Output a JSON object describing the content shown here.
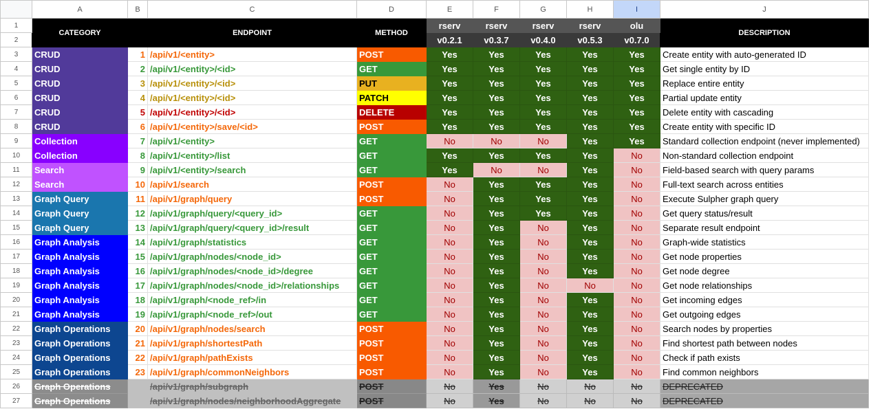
{
  "columns": [
    "A",
    "B",
    "C",
    "D",
    "E",
    "F",
    "G",
    "H",
    "I",
    "J"
  ],
  "selected_column": "I",
  "headers": {
    "category": "CATEGORY",
    "endpoint": "ENDPOINT",
    "method": "METHOD",
    "description": "DESCRIPTION",
    "versions": [
      {
        "name": "rserv",
        "ver": "v0.2.1"
      },
      {
        "name": "rserv",
        "ver": "v0.3.7"
      },
      {
        "name": "rserv",
        "ver": "v0.4.0"
      },
      {
        "name": "rserv",
        "ver": "v0.5.3"
      },
      {
        "name": "olu",
        "ver": "v0.7.0"
      }
    ]
  },
  "category_colors": {
    "CRUD": "#513a9a",
    "Collection": "#8800ff",
    "Search": "#c052ff",
    "Graph Query": "#1a76ae",
    "Graph Analysis": "#0000ff",
    "Graph Operations": "#0d4690"
  },
  "method_colors": {
    "POST": {
      "bg": "#f85a00",
      "fg": "#ffffff",
      "text": "#f4680a"
    },
    "GET": {
      "bg": "#38983a",
      "fg": "#ffffff",
      "text": "#38983a"
    },
    "PUT": {
      "bg": "#e8b120",
      "fg": "#000000",
      "text": "#b8900a"
    },
    "PATCH": {
      "bg": "#ffff00",
      "fg": "#000000",
      "text": "#b8900a"
    },
    "DELETE": {
      "bg": "#b80000",
      "fg": "#ffffff",
      "text": "#c00000"
    }
  },
  "rows": [
    {
      "category": "CRUD",
      "num": "1",
      "endpoint": "/api/v1/<entity>",
      "method": "POST",
      "support": [
        "Yes",
        "Yes",
        "Yes",
        "Yes",
        "Yes"
      ],
      "description": "Create entity with auto-generated ID"
    },
    {
      "category": "CRUD",
      "num": "2",
      "endpoint": "/api/v1/<entity>/<id>",
      "method": "GET",
      "support": [
        "Yes",
        "Yes",
        "Yes",
        "Yes",
        "Yes"
      ],
      "description": "Get single entity by ID"
    },
    {
      "category": "CRUD",
      "num": "3",
      "endpoint": "/api/v1/<entity>/<id>",
      "method": "PUT",
      "support": [
        "Yes",
        "Yes",
        "Yes",
        "Yes",
        "Yes"
      ],
      "description": "Replace entire entity"
    },
    {
      "category": "CRUD",
      "num": "4",
      "endpoint": "/api/v1/<entity>/<id>",
      "method": "PATCH",
      "support": [
        "Yes",
        "Yes",
        "Yes",
        "Yes",
        "Yes"
      ],
      "description": "Partial update entity"
    },
    {
      "category": "CRUD",
      "num": "5",
      "endpoint": "/api/v1/<entity>/<id>",
      "method": "DELETE",
      "support": [
        "Yes",
        "Yes",
        "Yes",
        "Yes",
        "Yes"
      ],
      "description": "Delete entity with cascading"
    },
    {
      "category": "CRUD",
      "num": "6",
      "endpoint": "/api/v1/<entity>/save/<id>",
      "method": "POST",
      "support": [
        "Yes",
        "Yes",
        "Yes",
        "Yes",
        "Yes"
      ],
      "description": "Create entity with specific ID"
    },
    {
      "category": "Collection",
      "num": "7",
      "endpoint": "/api/v1/<entity>",
      "method": "GET",
      "support": [
        "No",
        "No",
        "No",
        "Yes",
        "Yes"
      ],
      "description": "Standard collection endpoint (never implemented)"
    },
    {
      "category": "Collection",
      "num": "8",
      "endpoint": "/api/v1/<entity>/list",
      "method": "GET",
      "support": [
        "Yes",
        "Yes",
        "Yes",
        "Yes",
        "No"
      ],
      "description": "Non-standard collection endpoint"
    },
    {
      "category": "Search",
      "num": "9",
      "endpoint": "/api/v1/<entity>/search",
      "method": "GET",
      "support": [
        "Yes",
        "No",
        "No",
        "Yes",
        "No"
      ],
      "description": "Field-based search with query params"
    },
    {
      "category": "Search",
      "num": "10",
      "endpoint": "/api/v1/search",
      "method": "POST",
      "support": [
        "No",
        "Yes",
        "Yes",
        "Yes",
        "No"
      ],
      "description": "Full-text search across entities"
    },
    {
      "category": "Graph Query",
      "num": "11",
      "endpoint": "/api/v1/graph/query",
      "method": "POST",
      "support": [
        "No",
        "Yes",
        "Yes",
        "Yes",
        "No"
      ],
      "description": "Execute Sulpher graph query"
    },
    {
      "category": "Graph Query",
      "num": "12",
      "endpoint": "/api/v1/graph/query/<query_id>",
      "method": "GET",
      "support": [
        "No",
        "Yes",
        "Yes",
        "Yes",
        "No"
      ],
      "description": "Get query status/result"
    },
    {
      "category": "Graph Query",
      "num": "13",
      "endpoint": "/api/v1/graph/query/<query_id>/result",
      "method": "GET",
      "support": [
        "No",
        "Yes",
        "No",
        "Yes",
        "No"
      ],
      "description": "Separate result endpoint"
    },
    {
      "category": "Graph Analysis",
      "num": "14",
      "endpoint": "/api/v1/graph/statistics",
      "method": "GET",
      "support": [
        "No",
        "Yes",
        "No",
        "Yes",
        "No"
      ],
      "description": "Graph-wide statistics"
    },
    {
      "category": "Graph Analysis",
      "num": "15",
      "endpoint": "/api/v1/graph/nodes/<node_id>",
      "method": "GET",
      "support": [
        "No",
        "Yes",
        "No",
        "Yes",
        "No"
      ],
      "description": "Get node properties"
    },
    {
      "category": "Graph Analysis",
      "num": "16",
      "endpoint": "/api/v1/graph/nodes/<node_id>/degree",
      "method": "GET",
      "support": [
        "No",
        "Yes",
        "No",
        "Yes",
        "No"
      ],
      "description": "Get node degree"
    },
    {
      "category": "Graph Analysis",
      "num": "17",
      "endpoint": "/api/v1/graph/nodes/<node_id>/relationships",
      "method": "GET",
      "support": [
        "No",
        "Yes",
        "No",
        "No",
        "No"
      ],
      "description": "Get node relationships"
    },
    {
      "category": "Graph Analysis",
      "num": "18",
      "endpoint": "/api/v1/graph/<node_ref>/in",
      "method": "GET",
      "support": [
        "No",
        "Yes",
        "No",
        "Yes",
        "No"
      ],
      "description": "Get incoming edges"
    },
    {
      "category": "Graph Analysis",
      "num": "19",
      "endpoint": "/api/v1/graph/<node_ref>/out",
      "method": "GET",
      "support": [
        "No",
        "Yes",
        "No",
        "Yes",
        "No"
      ],
      "description": "Get outgoing edges"
    },
    {
      "category": "Graph Operations",
      "num": "20",
      "endpoint": "/api/v1/graph/nodes/search",
      "method": "POST",
      "support": [
        "No",
        "Yes",
        "No",
        "Yes",
        "No"
      ],
      "description": "Search nodes by properties"
    },
    {
      "category": "Graph Operations",
      "num": "21",
      "endpoint": "/api/v1/graph/shortestPath",
      "method": "POST",
      "support": [
        "No",
        "Yes",
        "No",
        "Yes",
        "No"
      ],
      "description": "Find shortest path between nodes"
    },
    {
      "category": "Graph Operations",
      "num": "22",
      "endpoint": "/api/v1/graph/pathExists",
      "method": "POST",
      "support": [
        "No",
        "Yes",
        "No",
        "Yes",
        "No"
      ],
      "description": "Check if path exists"
    },
    {
      "category": "Graph Operations",
      "num": "23",
      "endpoint": "/api/v1/graph/commonNeighbors",
      "method": "POST",
      "support": [
        "No",
        "Yes",
        "No",
        "Yes",
        "No"
      ],
      "description": "Find common neighbors"
    },
    {
      "category": "Graph Operations",
      "num": "",
      "endpoint": "/api/v1/graph/subgraph",
      "method": "POST",
      "support": [
        "No",
        "Yes",
        "No",
        "No",
        "No"
      ],
      "description": "DEPRECATED",
      "deprecated": true
    },
    {
      "category": "Graph Operations",
      "num": "",
      "endpoint": "/api/v1/graph/nodes/neighborhoodAggregate",
      "method": "POST",
      "support": [
        "No",
        "Yes",
        "No",
        "No",
        "No"
      ],
      "description": "DEPRECATED",
      "deprecated": true
    }
  ]
}
